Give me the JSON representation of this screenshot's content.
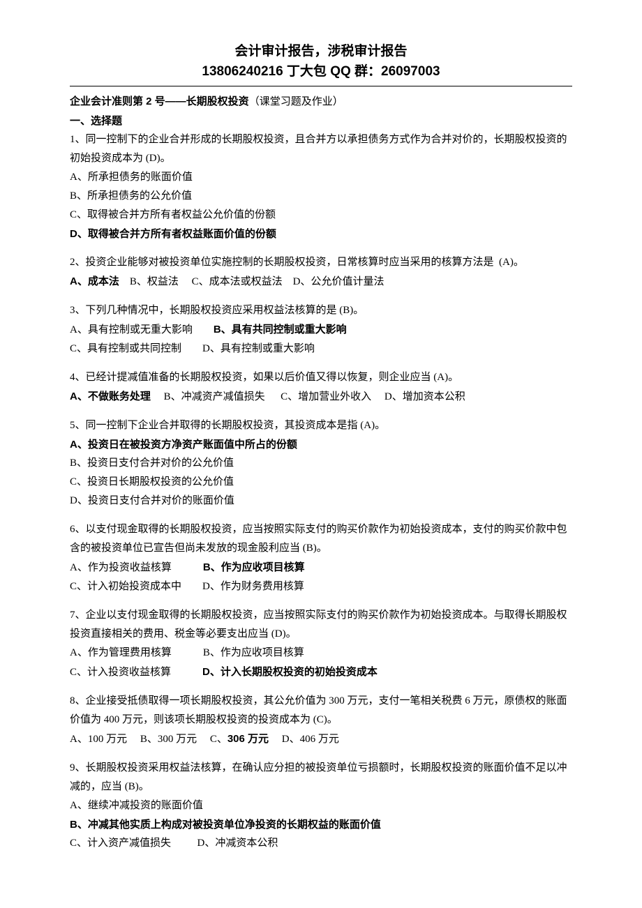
{
  "header": {
    "line1": "会计审计报告，涉税审计报告",
    "line2": "13806240216 丁大包    QQ 群：26097003"
  },
  "doc_title_prefix": "企业会计准则第 2 号——长期股权投资",
  "doc_title_suffix": "（课堂习题及作业）",
  "section_heading": "一、选择题",
  "q1": {
    "text": "1、同一控制下的企业合并形成的长期股权投资，且合并方以承担债务方式作为合并对价的，长期股权投资的初始投资成本为 (D)。",
    "a": "A、所承担债务的账面价值",
    "b": "B、所承担债务的公允价值",
    "c": "C、取得被合并方所有者权益公允价值的份额",
    "d": "D、取得被合并方所有者权益账面价值的份额"
  },
  "q2": {
    "text": "2、投资企业能够对被投资单位实施控制的长期股权投资，日常核算时应当采用的核算方法是  (A)。",
    "a": "A、成本法",
    "rest": "    B、权益法     C、成本法或权益法    D、公允价值计量法"
  },
  "q3": {
    "text": "3、下列几种情况中，长期股权投资应采用权益法核算的是 (B)。",
    "a_prefix": "A、具有控制或无重大影响        ",
    "b": "B、具有共同控制或重大影响",
    "cd": "C、具有控制或共同控制        D、具有控制或重大影响"
  },
  "q4": {
    "text": "4、已经计提减值准备的长期股权投资，如果以后价值又得以恢复，则企业应当 (A)。",
    "a": "A、不做账务处理",
    "rest": "     B、冲减资产减值损失      C、增加营业外收入     D、增加资本公积"
  },
  "q5": {
    "text": "5、同一控制下企业合并取得的长期股权投资，其投资成本是指 (A)。",
    "a": "A、投资日在被投资方净资产账面值中所占的份额",
    "b": "B、投资日支付合并对价的公允价值",
    "c": "C、投资日长期股权投资的公允价值",
    "d": "D、投资日支付合并对价的账面价值"
  },
  "q6": {
    "text": "6、以支付现金取得的长期股权投资，应当按照实际支付的购买价款作为初始投资成本，支付的购买价款中包含的被投资单位已宣告但尚未发放的现金股利应当 (B)。",
    "a_prefix": "A、作为投资收益核算            ",
    "b": "B、作为应收项目核算",
    "cd": "C、计入初始投资成本中        D、作为财务费用核算"
  },
  "q7": {
    "text": "7、企业以支付现金取得的长期股权投资，应当按照实际支付的购买价款作为初始投资成本。与取得长期股权投资直接相关的费用、税金等必要支出应当 (D)。",
    "ab": "A、作为管理费用核算            B、作为应收项目核算",
    "c_prefix": "C、计入投资收益核算            ",
    "d": "D、计入长期股权投资的初始投资成本"
  },
  "q8": {
    "text": "8、企业接受抵债取得一项长期股权投资，其公允价值为 300 万元，支付一笔相关税费 6 万元，原债权的账面价值为 400 万元，则该项长期股权投资的投资成本为 (C)。",
    "ab_prefix": "A、100 万元     B、300 万元     C、",
    "c": "306 万元",
    "d": "     D、406 万元"
  },
  "q9": {
    "text": "9、长期股权投资采用权益法核算，在确认应分担的被投资单位亏损额时，长期股权投资的账面价值不足以冲减的，应当 (B)。",
    "a": "A、继续冲减投资的账面价值",
    "b": "B、冲减其他实质上构成对被投资单位净投资的长期权益的账面价值",
    "cd": "C、计入资产减值损失          D、冲减资本公积"
  }
}
